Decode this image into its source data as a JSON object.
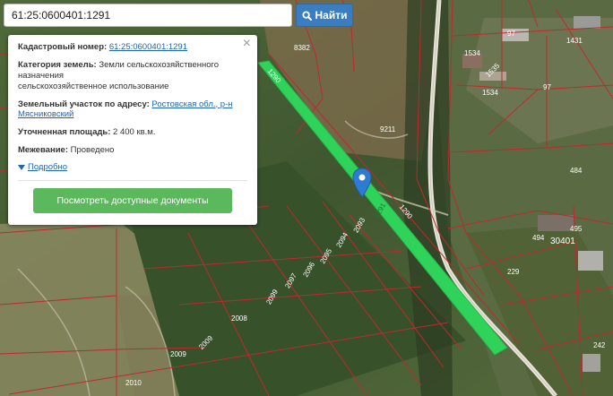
{
  "search": {
    "query": "61:25:0600401:1291",
    "button_label": "Найти"
  },
  "popup": {
    "close_glyph": "×",
    "cadastral_number_label": "Кадастровый номер:",
    "cadastral_number_value": "61:25:0600401:1291",
    "land_category_label": "Категория земель:",
    "land_category_value": "Земли сельскохозяйственного назначения",
    "land_category_value_line2": "сельскохозяйственное использование",
    "address_label": "Земельный участок по адресу:",
    "address_value": "Ростовская обл., р-н Мясниковский",
    "area_label": "Уточненная площадь:",
    "area_value": "2 400 кв.м.",
    "survey_label": "Межевание:",
    "survey_value": "Проведено",
    "more_link": "Подробно",
    "docs_button": "Посмотреть доступные документы"
  },
  "map": {
    "highlight_color": "#2fd35a",
    "boundary_color": "#c0292e",
    "marker_color": "#2f7bd1",
    "parcel_labels": {
      "l8382": "8382",
      "l1290a": "1290",
      "l9211": "9211",
      "l1290b": "1290",
      "l1291": "1291",
      "l2093": "2093",
      "l2094": "2094",
      "l2095": "2095",
      "l2096": "2096",
      "l2097": "2097",
      "l2099": "2099",
      "l2008": "2008",
      "l2009a": "2009",
      "l2009b": "2009",
      "l2010": "2010",
      "l1534a": "1534",
      "l1535": "1535",
      "l1534b": "1534",
      "l97a": "97",
      "l1431": "1431",
      "l97b": "97",
      "l484": "484",
      "l495": "495",
      "l494": "494",
      "l30401": "30401",
      "l229": "229",
      "l242": "242"
    }
  }
}
